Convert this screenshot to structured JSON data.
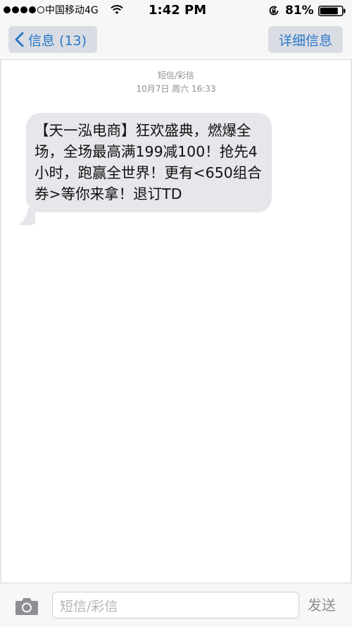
{
  "status_bar": {
    "carrier": "中国移动4G",
    "time": "1:42 PM",
    "battery_percent": "81%",
    "signal_dots": 5,
    "signal_filled": 4
  },
  "nav": {
    "back_label": "信息 (13)",
    "details_label": "详细信息"
  },
  "conversation": {
    "message_type": "短信/彩信",
    "date": "10月7日 周六 16:33",
    "messages": [
      {
        "direction": "incoming",
        "text": "【天一泓电商】狂欢盛典，燃爆全场，全场最高满199减100！抢先4小时，跑赢全世界！更有<650组合券>等你来拿！退订TD"
      }
    ]
  },
  "composer": {
    "placeholder": "短信/彩信",
    "send_label": "发送"
  },
  "colors": {
    "accent": "#2a76c9",
    "bubble": "#e6e6eb",
    "bar_background": "#f7f7f7",
    "muted_text": "#8e8e93"
  },
  "icons": {
    "camera": "camera-icon",
    "back": "chevron-left-icon",
    "wifi": "wifi-icon",
    "rotation_lock": "rotation-lock-icon",
    "battery": "battery-icon"
  }
}
